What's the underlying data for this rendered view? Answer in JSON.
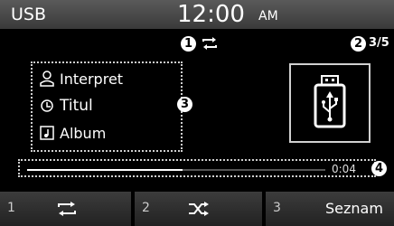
{
  "header": {
    "source": "USB",
    "time": "12:00",
    "ampm": "AM"
  },
  "callouts": {
    "one": "1",
    "two": "2",
    "three": "3",
    "four": "4"
  },
  "status": {
    "repeat_icon": "repeat-icon",
    "track": "3/5"
  },
  "info": {
    "artist": {
      "icon": "person-icon",
      "label": "Interpret"
    },
    "title": {
      "icon": "music-note-icon",
      "label": "Titul"
    },
    "album": {
      "icon": "album-icon",
      "label": "Album"
    }
  },
  "artwork": {
    "icon": "usb-icon"
  },
  "progress": {
    "elapsed": "0:04",
    "fraction": 0.52
  },
  "buttons": [
    {
      "num": "1",
      "icon": "repeat-icon"
    },
    {
      "num": "2",
      "icon": "shuffle-icon"
    },
    {
      "num": "3",
      "label": "Seznam"
    }
  ],
  "colors": {
    "background": "#000000",
    "text": "#ffffff"
  }
}
